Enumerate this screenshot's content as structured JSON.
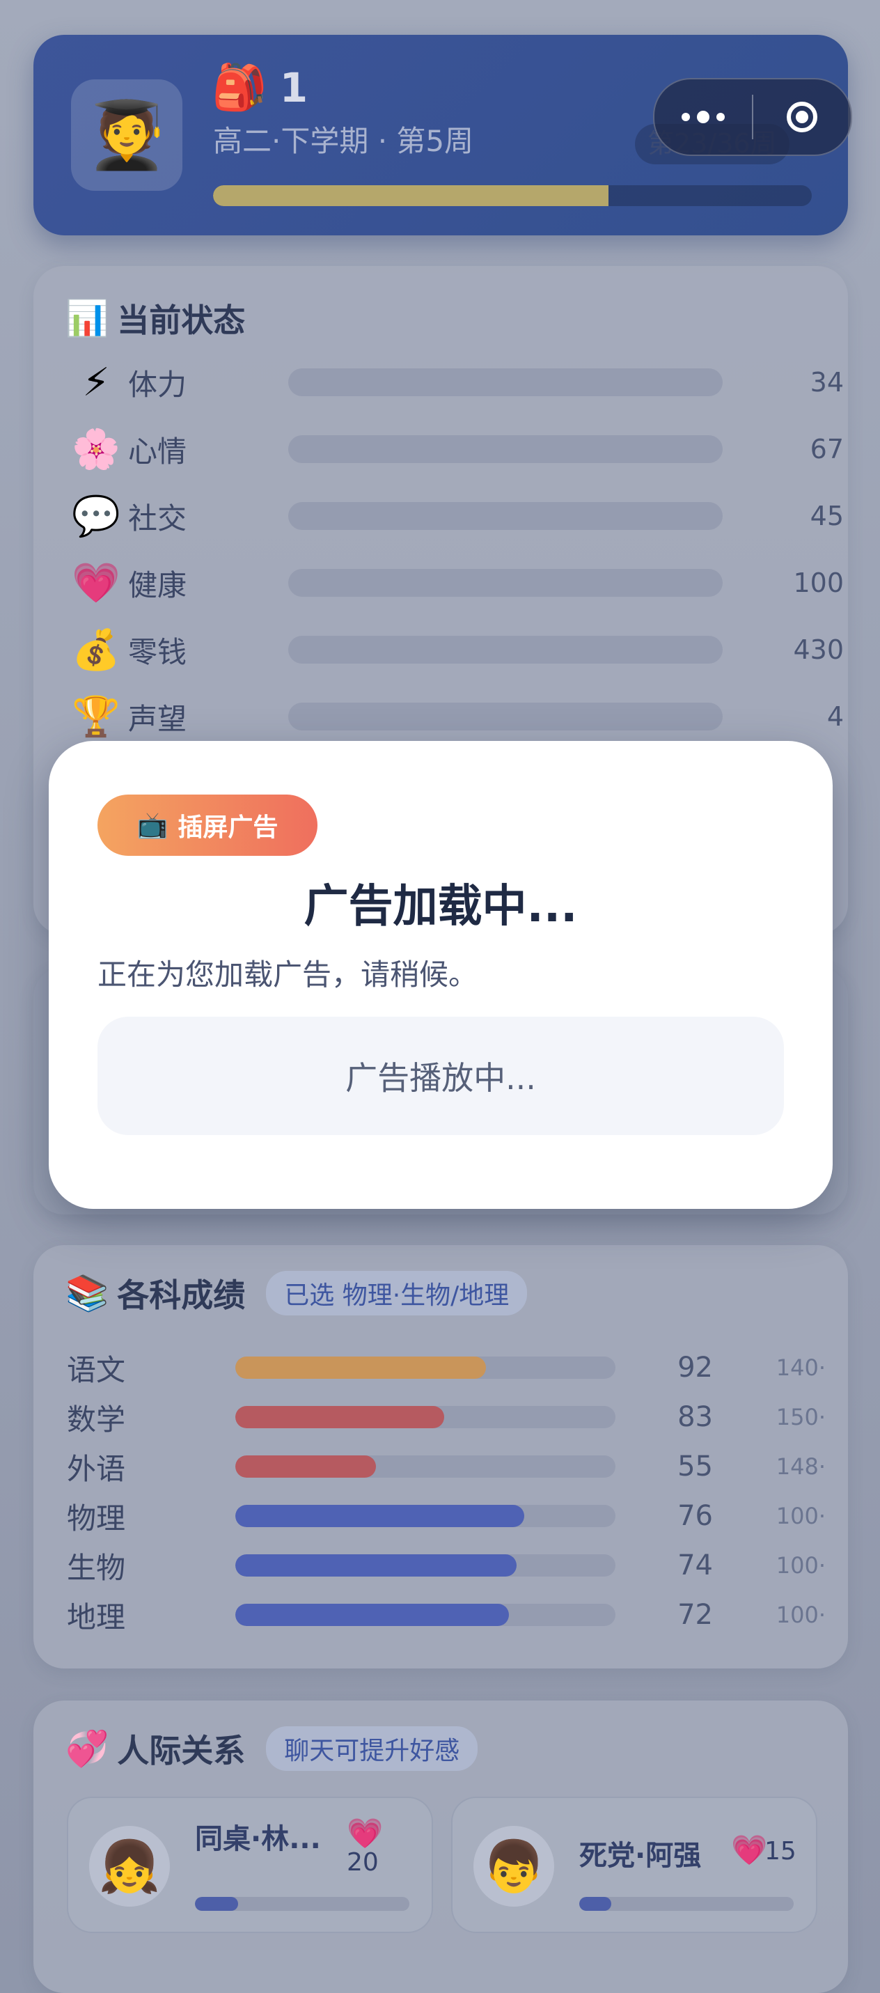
{
  "header": {
    "avatar_emoji": "🧑‍🎓",
    "bag_emoji": "🎒",
    "player_name": "1",
    "term": "高二·下学期 · 第5周",
    "week_badge": "第23/36周",
    "term_progress": 0.66
  },
  "status": {
    "title_emoji": "📊",
    "title": "当前状态",
    "items": [
      {
        "icon": "⚡",
        "label": "体力",
        "value": "34"
      },
      {
        "icon": "🌸",
        "label": "心情",
        "value": "67"
      },
      {
        "icon": "💬",
        "label": "社交",
        "value": "45"
      },
      {
        "icon": "💗",
        "label": "健康",
        "value": "100"
      },
      {
        "icon": "💰",
        "label": "零钱",
        "value": "430"
      },
      {
        "icon": "🏆",
        "label": "声望",
        "value": "4"
      }
    ]
  },
  "grades": {
    "title_emoji": "📚",
    "title": "各科成绩",
    "tag": "已选 物理·生物/地理",
    "items": [
      {
        "name": "语文",
        "score": "92",
        "max": "140·",
        "fraction": 0.66,
        "color": "#c9955a"
      },
      {
        "name": "数学",
        "score": "83",
        "max": "150·",
        "fraction": 0.55,
        "color": "#b65a60"
      },
      {
        "name": "外语",
        "score": "55",
        "max": "148·",
        "fraction": 0.37,
        "color": "#b65a60"
      },
      {
        "name": "物理",
        "score": "76",
        "max": "100·",
        "fraction": 0.76,
        "color": "#4f62b4"
      },
      {
        "name": "生物",
        "score": "74",
        "max": "100·",
        "fraction": 0.74,
        "color": "#4f62b4"
      },
      {
        "name": "地理",
        "score": "72",
        "max": "100·",
        "fraction": 0.72,
        "color": "#4f62b4"
      }
    ]
  },
  "relations": {
    "title_emoji": "💞",
    "title": "人际关系",
    "tag": "聊天可提升好感",
    "friends": [
      {
        "avatar": "👧",
        "name": "同桌·林...",
        "heart": "💗",
        "affinity": "20",
        "fraction": 0.2
      },
      {
        "avatar": "👦",
        "name": "死党·阿强",
        "heart": "💗",
        "affinity": "15",
        "fraction": 0.15
      }
    ]
  },
  "modal": {
    "badge_icon": "📺",
    "badge_text": "插屏广告",
    "title": "广告加载中...",
    "desc": "正在为您加载广告，请稍候。",
    "box_text": "广告播放中..."
  }
}
